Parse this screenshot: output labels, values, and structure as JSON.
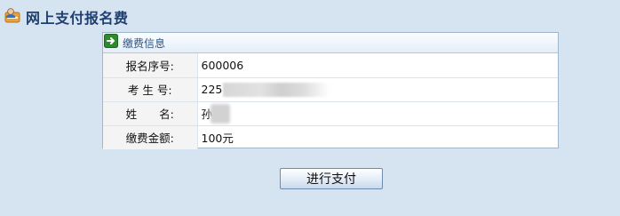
{
  "page": {
    "title": "网上支付报名费",
    "title_icon": "user-card-icon"
  },
  "panel": {
    "title": "缴费信息",
    "header_icon": "arrow-right-icon",
    "rows": [
      {
        "label": "报名序号:",
        "value": "600006"
      },
      {
        "label": "考 生 号:",
        "value": "225"
      },
      {
        "label": "姓　　名:",
        "value": "孙"
      },
      {
        "label": "缴费金额:",
        "value": "100元"
      }
    ]
  },
  "actions": {
    "pay_label": "进行支付"
  },
  "colors": {
    "background": "#d6e4f1",
    "title": "#1f3f70",
    "panel_title": "#2f5588",
    "header_icon": "#2f8a2f"
  }
}
